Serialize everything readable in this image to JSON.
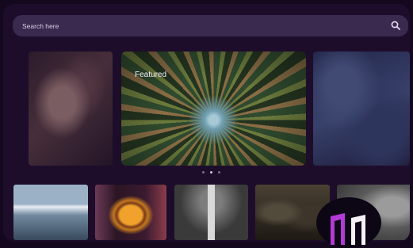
{
  "search": {
    "placeholder": "Search here",
    "icon": "search-icon"
  },
  "carousel": {
    "featured_label": "Featured",
    "slides": 3,
    "active_index": 1
  },
  "thumbnails": [
    {
      "subject": "snowy-mountains"
    },
    {
      "subject": "burger"
    },
    {
      "subject": "lighthouse"
    },
    {
      "subject": "people-dim-room"
    },
    {
      "subject": "monochrome-face"
    }
  ],
  "colors": {
    "background": "#1d0d2b",
    "search_bar": "#3a2a4f",
    "logo_accent": "#b43ad6"
  }
}
